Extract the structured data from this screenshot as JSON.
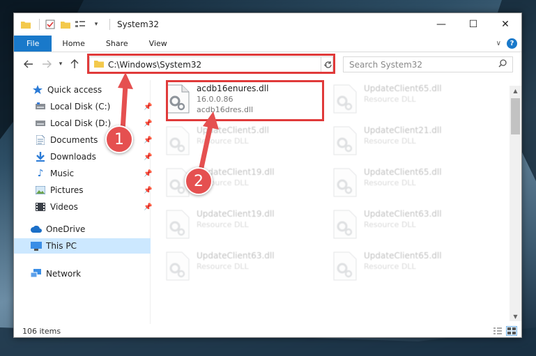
{
  "window": {
    "title": "System32",
    "controls": {
      "minimize": "—",
      "maximize": "☐",
      "close": "✕"
    }
  },
  "ribbon": {
    "tabs": [
      {
        "label": "File",
        "active": true
      },
      {
        "label": "Home"
      },
      {
        "label": "Share"
      },
      {
        "label": "View"
      }
    ],
    "help": "?"
  },
  "navigation": {
    "address": "C:\\Windows\\System32",
    "search_placeholder": "Search System32"
  },
  "sidebar": {
    "items": [
      {
        "label": "Quick access",
        "icon": "star-icon",
        "pinned": false
      },
      {
        "label": "Local Disk (C:)",
        "icon": "drive-icon",
        "pinned": true
      },
      {
        "label": "Local Disk (D:)",
        "icon": "drive-icon",
        "pinned": true
      },
      {
        "label": "Documents",
        "icon": "documents-icon",
        "pinned": true
      },
      {
        "label": "Downloads",
        "icon": "downloads-icon",
        "pinned": true
      },
      {
        "label": "Music",
        "icon": "music-icon",
        "pinned": true
      },
      {
        "label": "Pictures",
        "icon": "pictures-icon",
        "pinned": true
      },
      {
        "label": "Videos",
        "icon": "videos-icon",
        "pinned": true
      },
      {
        "label": "OneDrive",
        "icon": "cloud-icon",
        "pinned": false
      },
      {
        "label": "This PC",
        "icon": "computer-icon",
        "pinned": false,
        "selected": true
      },
      {
        "label": "Network",
        "icon": "network-icon",
        "pinned": false
      }
    ]
  },
  "files": [
    {
      "name": "acdb16enures.dll",
      "line2": "16.0.0.86",
      "line3": "acdb16dres.dll",
      "highlighted": true
    },
    {
      "name": "UpdateClient65.dll",
      "line2": "Resource DLL"
    },
    {
      "name": "UpdateClient5.dll",
      "line2": "Resource DLL"
    },
    {
      "name": "UpdateClient21.dll",
      "line2": "Resource DLL"
    },
    {
      "name": "UpdateClient19.dll",
      "line2": "Resource DLL"
    },
    {
      "name": "UpdateClient65.dll",
      "line2": "Resource DLL"
    },
    {
      "name": "UpdateClient19.dll",
      "line2": "Resource DLL"
    },
    {
      "name": "UpdateClient63.dll",
      "line2": "Resource DLL"
    },
    {
      "name": "UpdateClient63.dll",
      "line2": "Resource DLL"
    },
    {
      "name": "UpdateClient65.dll",
      "line2": "Resource DLL"
    }
  ],
  "status": {
    "item_count": "106 items"
  },
  "annotations": {
    "step1": "1",
    "step2": "2"
  },
  "colors": {
    "accent": "#1979ca",
    "annotation": "#e03a3a",
    "selected": "#cce8ff"
  }
}
